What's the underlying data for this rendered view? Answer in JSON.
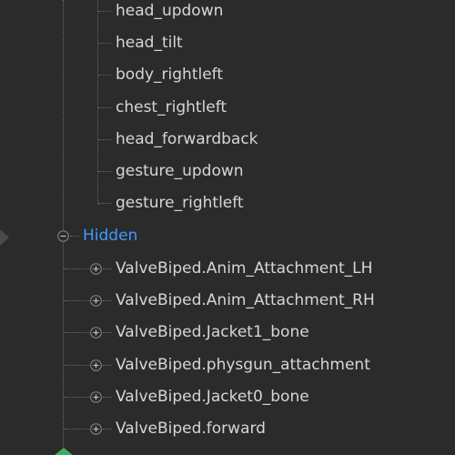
{
  "tree": {
    "upper_children": [
      {
        "label": "head_updown"
      },
      {
        "label": "head_tilt"
      },
      {
        "label": "body_rightleft"
      },
      {
        "label": "chest_rightleft"
      },
      {
        "label": "head_forwardback"
      },
      {
        "label": "gesture_updown"
      },
      {
        "label": "gesture_rightleft"
      }
    ],
    "hidden_group": {
      "label": "Hidden",
      "expanded": true,
      "label_color": "#3d9bff",
      "children": [
        {
          "label": "ValveBiped.Anim_Attachment_LH",
          "expander_icon": "plus-expander-icon"
        },
        {
          "label": "ValveBiped.Anim_Attachment_RH",
          "expander_icon": "plus-expander-icon"
        },
        {
          "label": "ValveBiped.Jacket1_bone",
          "expander_icon": "plus-expander-icon"
        },
        {
          "label": "ValveBiped.physgun_attachment",
          "expander_icon": "plus-expander-icon"
        },
        {
          "label": "ValveBiped.Jacket0_bone",
          "expander_icon": "plus-expander-icon"
        },
        {
          "label": "ValveBiped.forward",
          "expander_icon": "plus-expander-icon"
        }
      ]
    }
  },
  "colors": {
    "background": "#2b2b2b",
    "text": "#d6d6d6",
    "tree_lines": "#6a6a6a",
    "accent": "#3d9bff",
    "green_icon": "#3fae5a"
  }
}
